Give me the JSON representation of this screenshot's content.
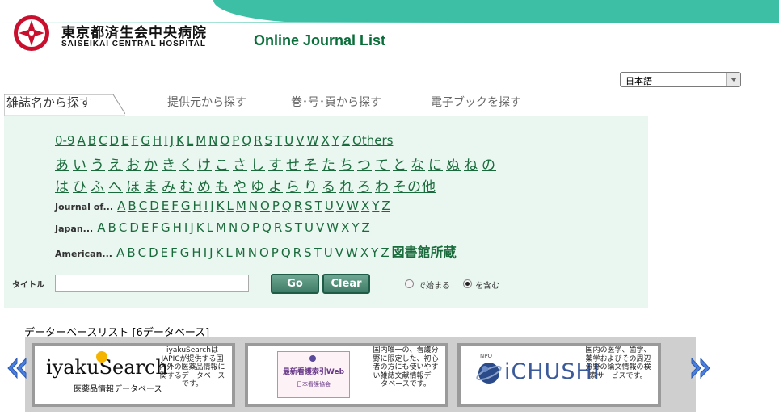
{
  "header": {
    "logo_jp": "東京都済生会中央病院",
    "logo_en": "SAISEIKAI CENTRAL HOSPITAL",
    "page_title": "Online Journal List"
  },
  "language_select": {
    "value": "日本語"
  },
  "tabs": [
    {
      "label": "雑誌名から探す",
      "active": true
    },
    {
      "label": "提供元から探す"
    },
    {
      "label": "巻･号･頁から探す"
    },
    {
      "label": "電子ブックを探す"
    }
  ],
  "alpha": {
    "row1": [
      "0-9",
      "A",
      "B",
      "C",
      "D",
      "E",
      "F",
      "G",
      "H",
      "I",
      "J",
      "K",
      "L",
      "M",
      "N",
      "O",
      "P",
      "Q",
      "R",
      "S",
      "T",
      "U",
      "V",
      "W",
      "X",
      "Y",
      "Z",
      "Others"
    ],
    "row2": [
      "あ",
      "い",
      "う",
      "え",
      "お",
      "か",
      "き",
      "く",
      "け",
      "こ",
      "さ",
      "し",
      "す",
      "せ",
      "そ",
      "た",
      "ち",
      "つ",
      "て",
      "と",
      "な",
      "に",
      "ぬ",
      "ね",
      "の"
    ],
    "row3": [
      "は",
      "ひ",
      "ふ",
      "へ",
      "ほ",
      "ま",
      "み",
      "む",
      "め",
      "も",
      "や",
      "ゆ",
      "よ",
      "ら",
      "り",
      "る",
      "れ",
      "ろ",
      "わ",
      "その他"
    ],
    "journal_prefix": "Journal of...",
    "japan_prefix": "Japan...",
    "american_prefix": "American...",
    "letters": [
      "A",
      "B",
      "C",
      "D",
      "E",
      "F",
      "G",
      "H",
      "I",
      "J",
      "K",
      "L",
      "M",
      "N",
      "O",
      "P",
      "Q",
      "R",
      "S",
      "T",
      "U",
      "V",
      "W",
      "X",
      "Y",
      "Z"
    ],
    "library_link": "図書館所蔵"
  },
  "search": {
    "label": "タイトル",
    "go": "Go",
    "clear": "Clear",
    "radio_starts": "で始まる",
    "radio_contains": "を含む",
    "selected": "contains"
  },
  "databases": {
    "heading": "データーベースリスト [6データベース]",
    "items": [
      {
        "logo_text": "iyakuSearch",
        "logo_sub": "医薬品情報データベース",
        "desc": "iyakuSearchはJAPICが提供する国内外の医薬品情報に関するデータベースです。"
      },
      {
        "logo_text": "最新看護索引Web",
        "logo_sub": "日本看護協会",
        "desc": "国内唯一の、看護分野に限定した、初心者の方にも使いやすい雑誌文献情報データベースです。"
      },
      {
        "logo_text": "iCHUSHI",
        "logo_sub": "NPO",
        "desc": "国内の医学、歯学、薬学およびその周辺分野の論文情報の検索サービスです。"
      }
    ]
  },
  "colors": {
    "accent": "#3dbfa6",
    "link": "#1a6b3c",
    "title": "#0a6e3a",
    "panel": "#eaf7f1"
  }
}
